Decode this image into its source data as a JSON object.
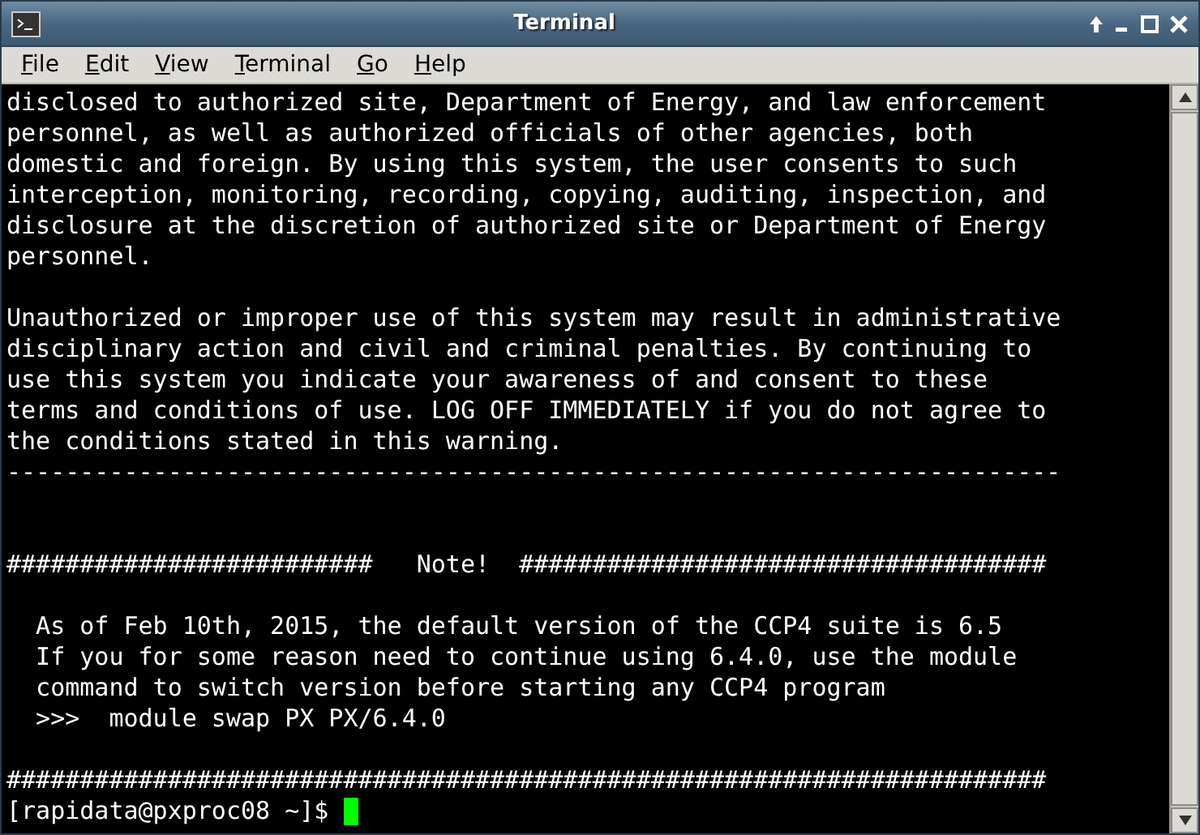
{
  "window": {
    "title": "Terminal"
  },
  "menu": [
    {
      "label": "File"
    },
    {
      "label": "Edit"
    },
    {
      "label": "View"
    },
    {
      "label": "Terminal"
    },
    {
      "label": "Go"
    },
    {
      "label": "Help"
    }
  ],
  "terminal": {
    "lines": [
      {
        "kind": "text",
        "text": "disclosed to authorized site, Department of Energy, and law enforcement"
      },
      {
        "kind": "text",
        "text": "personnel, as well as authorized officials of other agencies, both"
      },
      {
        "kind": "text",
        "text": "domestic and foreign. By using this system, the user consents to such"
      },
      {
        "kind": "text",
        "text": "interception, monitoring, recording, copying, auditing, inspection, and"
      },
      {
        "kind": "text",
        "text": "disclosure at the discretion of authorized site or Department of Energy"
      },
      {
        "kind": "text",
        "text": "personnel."
      },
      {
        "kind": "blank"
      },
      {
        "kind": "text",
        "text": "Unauthorized or improper use of this system may result in administrative"
      },
      {
        "kind": "text",
        "text": "disciplinary action and civil and criminal penalties. By continuing to"
      },
      {
        "kind": "text",
        "text": "use this system you indicate your awareness of and consent to these"
      },
      {
        "kind": "text",
        "text": "terms and conditions of use. LOG OFF IMMEDIATELY if you do not agree to"
      },
      {
        "kind": "text",
        "text": "the conditions stated in this warning."
      },
      {
        "kind": "text",
        "text": "------------------------------------------------------------------------"
      },
      {
        "kind": "blank"
      },
      {
        "kind": "blank"
      },
      {
        "kind": "text",
        "text": "#########################   Note!  ####################################"
      },
      {
        "kind": "blank"
      },
      {
        "kind": "text",
        "text": "  As of Feb 10th, 2015, the default version of the CCP4 suite is 6.5"
      },
      {
        "kind": "text",
        "text": "  If you for some reason need to continue using 6.4.0, use the module"
      },
      {
        "kind": "text",
        "text": "  command to switch version before starting any CCP4 program"
      },
      {
        "kind": "text",
        "text": "  >>>  module swap PX PX/6.4.0"
      },
      {
        "kind": "blank"
      },
      {
        "kind": "text",
        "text": "#######################################################################"
      }
    ],
    "prompt": "[rapidata@pxproc08 ~]$"
  }
}
